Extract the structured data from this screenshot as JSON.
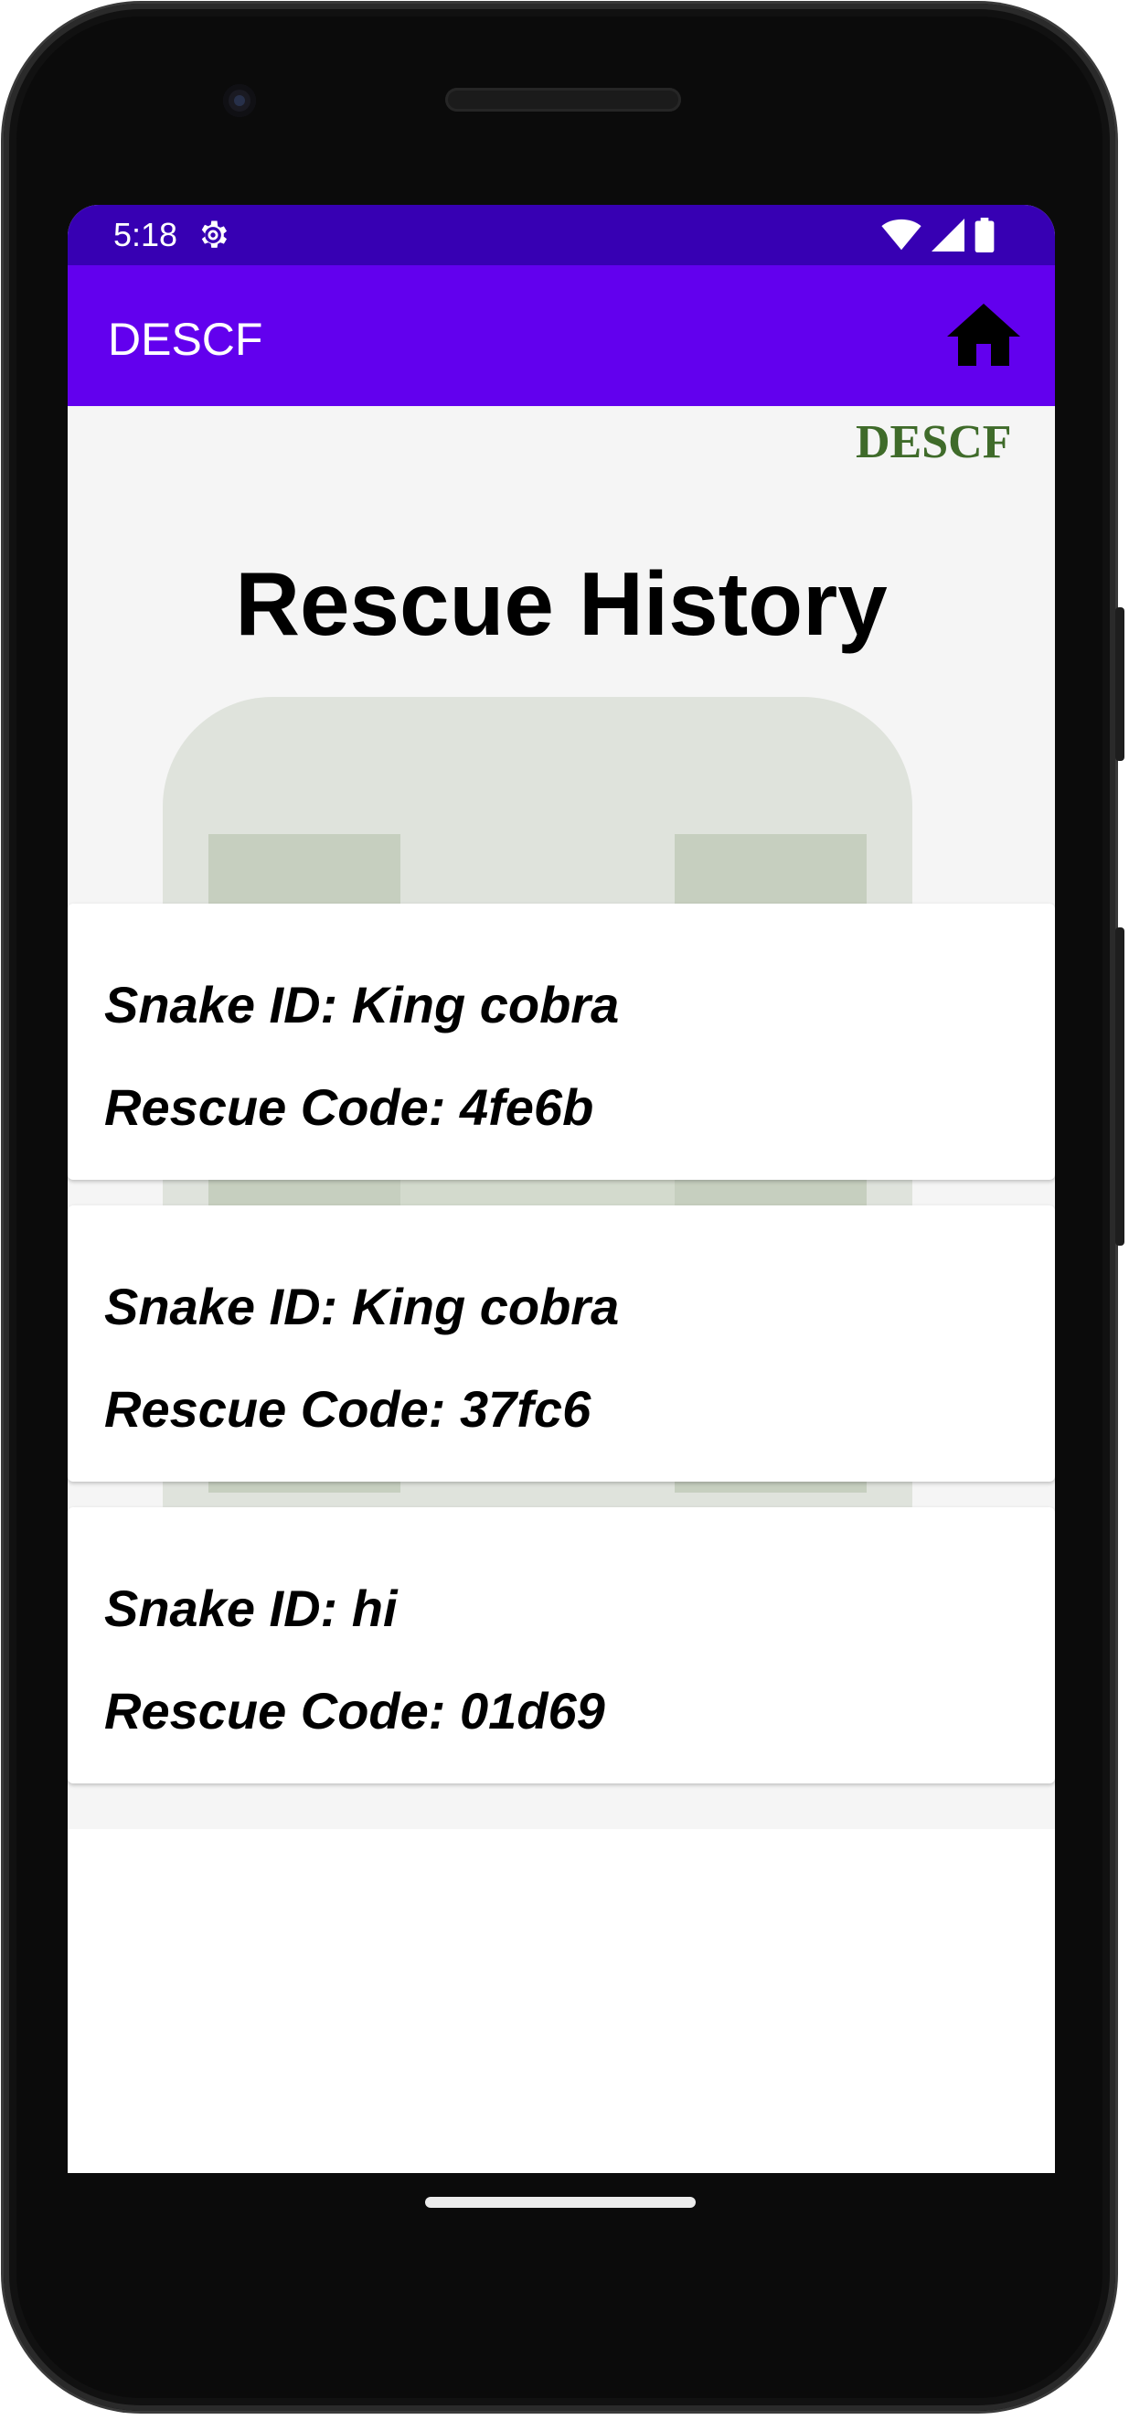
{
  "status_bar": {
    "time": "5:18"
  },
  "app_bar": {
    "title": "DESCF"
  },
  "logo": {
    "text": "DESCF"
  },
  "page": {
    "heading": "Rescue History"
  },
  "records": [
    {
      "snake_id": "Snake ID: King cobra",
      "rescue_code": "Rescue Code: 4fe6b"
    },
    {
      "snake_id": "Snake ID: King cobra",
      "rescue_code": "Rescue Code: 37fc6"
    },
    {
      "snake_id": "Snake ID: hi",
      "rescue_code": "Rescue Code: 01d69"
    }
  ],
  "icons": {
    "status": [
      "settings-gear-icon",
      "wifi-icon",
      "cellular-signal-icon",
      "battery-icon"
    ],
    "app_bar": "home-icon"
  },
  "colors": {
    "status_bar": "#3700b3",
    "app_bar": "#6200ee",
    "logo_green": "#3f6b2a",
    "background": "#f5f5f5"
  }
}
